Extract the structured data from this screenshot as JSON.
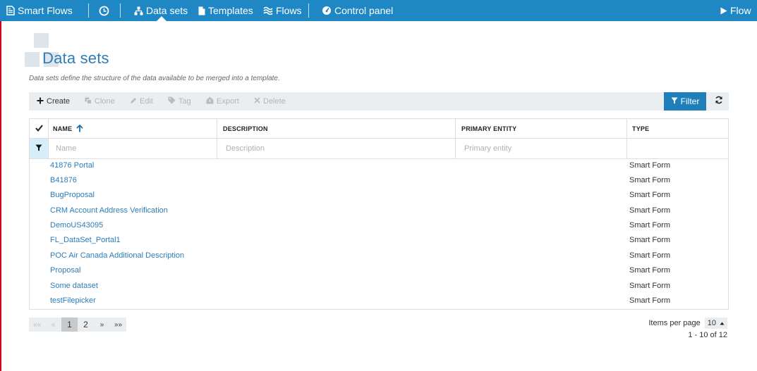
{
  "nav": {
    "brand": "Smart Flows",
    "items": [
      {
        "label": "Data sets",
        "icon": "sitemap-icon"
      },
      {
        "label": "Templates",
        "icon": "file-icon"
      },
      {
        "label": "Flows",
        "icon": "waves-icon"
      },
      {
        "label": "Control panel",
        "icon": "gauge-icon"
      }
    ],
    "right": "Flow"
  },
  "page": {
    "title": "Data sets",
    "subtitle": "Data sets define the structure of the data available to be merged into a template."
  },
  "toolbar": {
    "create": "Create",
    "clone": "Clone",
    "edit": "Edit",
    "tag": "Tag",
    "export": "Export",
    "delete": "Delete",
    "filter": "Filter"
  },
  "grid": {
    "columns": [
      "NAME",
      "DESCRIPTION",
      "PRIMARY ENTITY",
      "TYPE"
    ],
    "placeholders": {
      "name": "Name",
      "description": "Description",
      "primary_entity": "Primary entity"
    },
    "rows": [
      {
        "name": "41876 Portal",
        "description": "",
        "primary_entity": "",
        "type": "Smart Form"
      },
      {
        "name": "B41876",
        "description": "",
        "primary_entity": "",
        "type": "Smart Form"
      },
      {
        "name": "BugProposal",
        "description": "",
        "primary_entity": "",
        "type": "Smart Form"
      },
      {
        "name": "CRM Account Address Verification",
        "description": "",
        "primary_entity": "",
        "type": "Smart Form"
      },
      {
        "name": "DemoUS43095",
        "description": "",
        "primary_entity": "",
        "type": "Smart Form"
      },
      {
        "name": "FL_DataSet_Portal1",
        "description": "",
        "primary_entity": "",
        "type": "Smart Form"
      },
      {
        "name": "POC Air Canada Additional Description",
        "description": "",
        "primary_entity": "",
        "type": "Smart Form"
      },
      {
        "name": "Proposal",
        "description": "",
        "primary_entity": "",
        "type": "Smart Form"
      },
      {
        "name": "Some dataset",
        "description": "",
        "primary_entity": "",
        "type": "Smart Form"
      },
      {
        "name": "testFilepicker",
        "description": "",
        "primary_entity": "",
        "type": "Smart Form"
      }
    ]
  },
  "pager": {
    "first": "««",
    "prev": "«",
    "pages": [
      "1",
      "2"
    ],
    "current": "1",
    "next": "»",
    "last": "»»",
    "items_per_page_label": "Items per page",
    "items_per_page": "10",
    "range": "1 - 10 of 12"
  },
  "colors": {
    "nav_bg": "#1e87c4",
    "link": "#2c7cb8",
    "filter_button": "#1e7fba"
  }
}
